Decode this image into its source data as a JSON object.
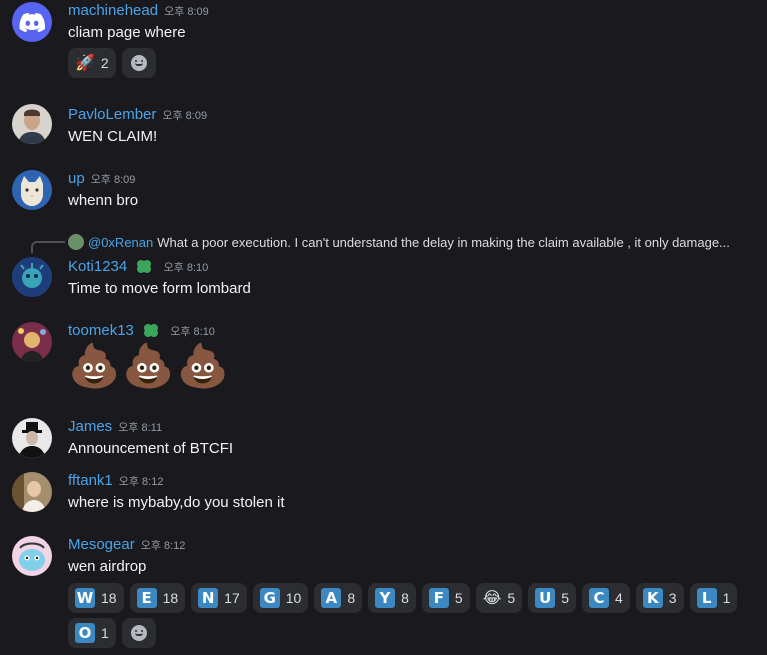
{
  "timestamp_prefix": "오후",
  "messages": [
    {
      "author": "machinehead",
      "time": "오후 8:09",
      "text": "cliam page where",
      "reactions": [
        {
          "emoji": "🚀",
          "count": "2"
        }
      ]
    },
    {
      "author": "PavloLember",
      "time": "오후 8:09",
      "text": "WEN CLAIM!"
    },
    {
      "author": "up",
      "time": "오후 8:09",
      "text": "whenn bro"
    },
    {
      "author": "Koti1234",
      "time": "오후 8:10",
      "text": "Time to move form lombard",
      "reply": {
        "author": "@0xRenan",
        "text": "What a poor execution. I can't understand the delay in making the claim available , it only damage..."
      }
    },
    {
      "author": "toomek13",
      "time": "오후 8:10",
      "emoji_text": "💩💩💩"
    },
    {
      "author": "James",
      "time": "오후 8:11",
      "text": "Announcement of BTCFI"
    },
    {
      "author": "fftank1",
      "time": "오후 8:12",
      "text": "where is mybaby,do you stolen it"
    },
    {
      "author": "Mesogear",
      "time": "오후 8:12",
      "text": "wen airdrop",
      "reactions": [
        {
          "letter": "W",
          "count": "18"
        },
        {
          "letter": "E",
          "count": "18"
        },
        {
          "letter": "N",
          "count": "17"
        },
        {
          "letter": "G",
          "count": "10"
        },
        {
          "letter": "A",
          "count": "8"
        },
        {
          "letter": "Y",
          "count": "8"
        },
        {
          "letter": "F",
          "count": "5"
        },
        {
          "emoji": "😂",
          "count": "5"
        },
        {
          "letter": "U",
          "count": "5"
        },
        {
          "letter": "C",
          "count": "4"
        },
        {
          "letter": "K",
          "count": "3"
        },
        {
          "letter": "L",
          "count": "1"
        },
        {
          "letter": "O",
          "count": "1"
        }
      ]
    }
  ],
  "icons": {
    "discord": "discord-logo-icon",
    "add_reaction": "add-reaction-icon",
    "tag": "clover-tag-icon"
  },
  "colors": {
    "background": "#1a1a1e",
    "username": "#4aa3e8",
    "reaction_bg": "#2b2d31",
    "letter_tile": "#3b88c3"
  }
}
